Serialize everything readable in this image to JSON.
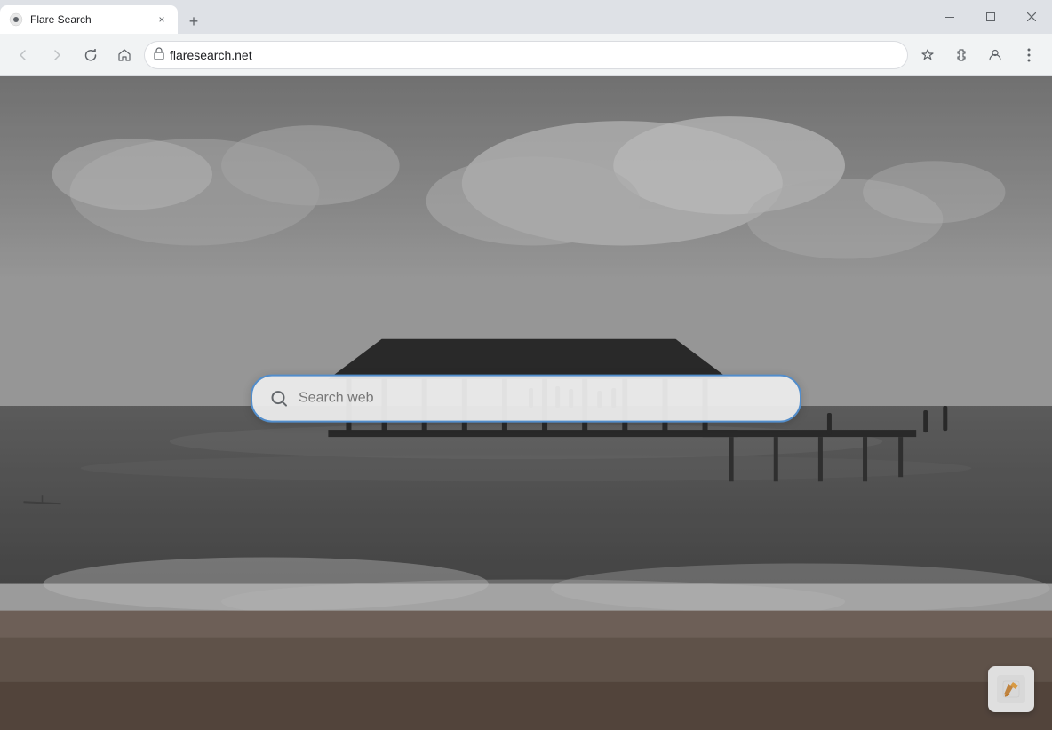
{
  "browser": {
    "tab": {
      "favicon_label": "search-favicon",
      "title": "Flare Search",
      "close_label": "×"
    },
    "new_tab_label": "+",
    "window_controls": {
      "minimize_label": "─",
      "maximize_label": "□",
      "close_label": "✕"
    },
    "nav": {
      "back_label": "←",
      "forward_label": "→",
      "reload_label": "↻",
      "home_label": "⌂",
      "address": "flaresearch.net",
      "star_label": "☆",
      "extensions_label": "🧩",
      "profile_label": "👤",
      "menu_label": "⋮"
    }
  },
  "page": {
    "search_placeholder": "Search web",
    "search_icon_label": "search-icon",
    "flare_icon_label": "flare-logo-icon"
  }
}
